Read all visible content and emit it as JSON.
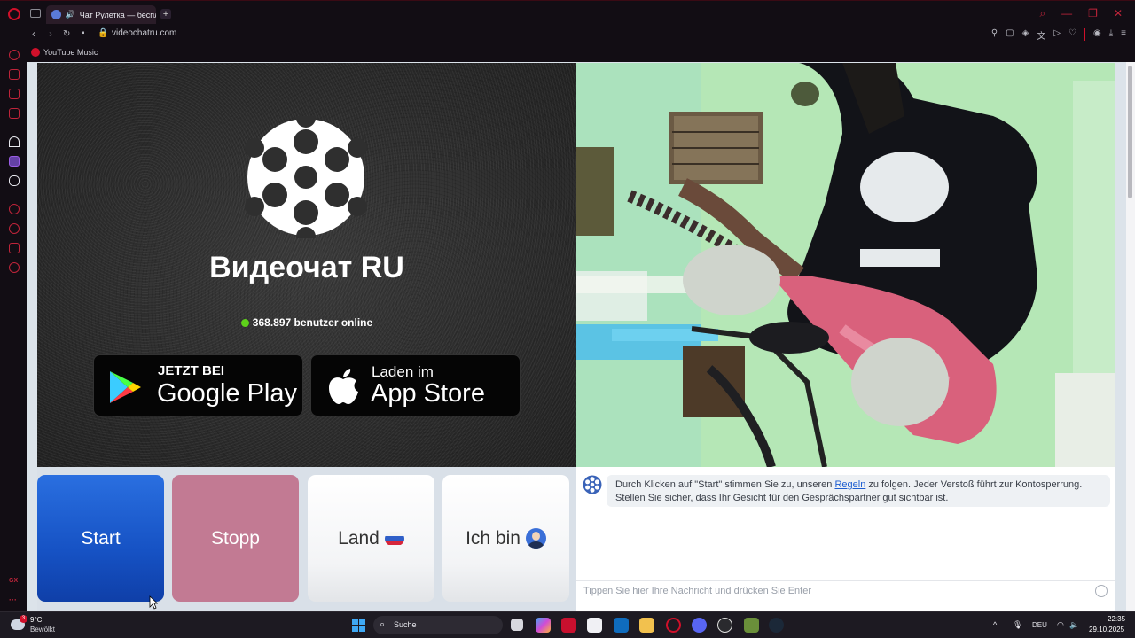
{
  "browser": {
    "tab_title": "Чат Рулетка — беспл",
    "address": "videochatru.com",
    "bookmark": "YouTube Music",
    "sidebar_badge": "GX"
  },
  "left_panel": {
    "brand": "Видеочат RU",
    "online_text": "368.897 benutzer online",
    "google_play": {
      "small": "JETZT BEI",
      "big": "Google Play"
    },
    "app_store": {
      "small": "Laden im",
      "big": "App Store"
    }
  },
  "controls": {
    "start": "Start",
    "stop": "Stopp",
    "land": "Land",
    "ich_bin": "Ich bin"
  },
  "chat": {
    "message_before_link": "Durch Klicken auf \"Start\" stimmen Sie zu, unseren ",
    "message_link": "Regeln",
    "message_after_link": " zu folgen. Jeder Verstoß führt zur Kontosperrung. Stellen Sie sicher, dass Ihr Gesicht für den Gesprächspartner gut sichtbar ist.",
    "input_placeholder": "Tippen Sie hier Ihre Nachricht und drücken Sie Enter"
  },
  "taskbar": {
    "weather_temp": "9°C",
    "weather_desc": "Bewölkt",
    "weather_badge": "3",
    "search_label": "Suche",
    "language": "DEU",
    "time": "22:35",
    "date": "29.10.2025"
  },
  "colors": {
    "opera_red": "#d0102a",
    "start_blue": "#1652c4",
    "stop_pink": "#c27a93",
    "online_green": "#5ed21a"
  }
}
